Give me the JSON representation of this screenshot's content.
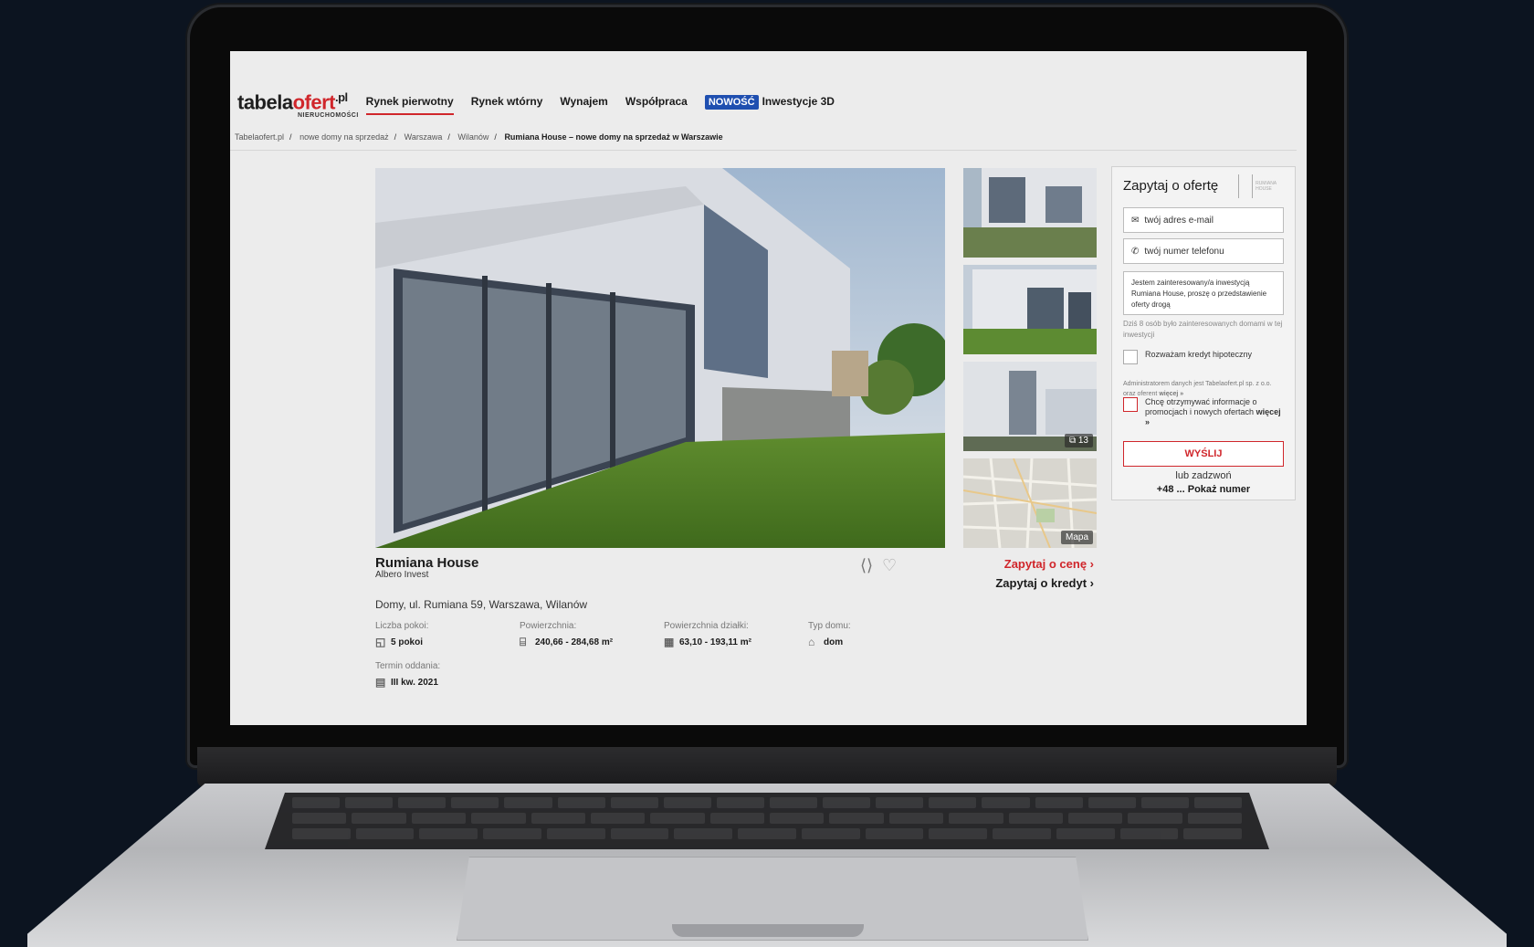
{
  "header": {
    "logo": {
      "part1": "tabela",
      "part2": "ofert",
      "tld": ".pl",
      "subtitle": "NIERUCHOMOŚCI"
    },
    "nav": [
      {
        "label": "Rynek pierwotny",
        "active": true
      },
      {
        "label": "Rynek wtórny"
      },
      {
        "label": "Wynajem"
      },
      {
        "label": "Współpraca"
      }
    ],
    "new_badge": "NOWOŚĆ",
    "new_item": "Inwestycje 3D"
  },
  "breadcrumb": [
    "Tabelaofert.pl",
    "nowe domy na sprzedaż",
    "Warszawa",
    "Wilanów",
    "Rumiana House – nowe domy na sprzedaż w Warszawie"
  ],
  "breadcrumb_sep": "/",
  "gallery": {
    "photo_count": "13",
    "map_label": "Mapa"
  },
  "listing": {
    "title": "Rumiana House",
    "developer": "Albero Invest",
    "address": "Domy, ul. Rumiana 59, Warszawa, Wilanów",
    "ask_price": "Zapytaj o cenę ›",
    "ask_credit": "Zapytaj o kredyt ›",
    "specs": [
      {
        "label": "Liczba pokoi:",
        "value": "5 pokoi",
        "icon": "rooms-icon"
      },
      {
        "label": "Powierzchnia:",
        "value": "240,66 - 284,68 m²",
        "icon": "area-icon"
      },
      {
        "label": "Powierzchnia działki:",
        "value": "63,10 - 193,11 m²",
        "icon": "plot-icon"
      },
      {
        "label": "Typ domu:",
        "value": "dom",
        "icon": "house-icon"
      },
      {
        "label": "Termin oddania:",
        "value": "III kw. 2021",
        "icon": "calendar-icon"
      }
    ]
  },
  "form": {
    "title": "Zapytaj o ofertę",
    "brand": "RUMIANA HOUSE",
    "email_placeholder": "twój adres e-mail",
    "phone_placeholder": "twój numer telefonu",
    "message": "Jestem zainteresowany/a inwestycją Rumiana House, proszę o przedstawienie oferty drogą",
    "interest_note": "Dziś 8 osób było zainteresowanych domami w tej inwestycji",
    "mortgage_label": "Rozważam kredyt hipoteczny",
    "admin_note": "Administratorem danych jest Tabelaofert.pl sp. z o.o. oraz oferent",
    "admin_more": "więcej »",
    "promo_label": "Chcę otrzymywać informacje o promocjach i nowych ofertach",
    "promo_more": "więcej »",
    "send_label": "WYŚLIJ",
    "or_call": "lub zadzwoń",
    "phone_prefix": "+48 ...",
    "show_number": "Pokaż numer"
  },
  "colors": {
    "accent": "#d0262b",
    "badge": "#1f4fb0",
    "background": "#0c1420"
  }
}
